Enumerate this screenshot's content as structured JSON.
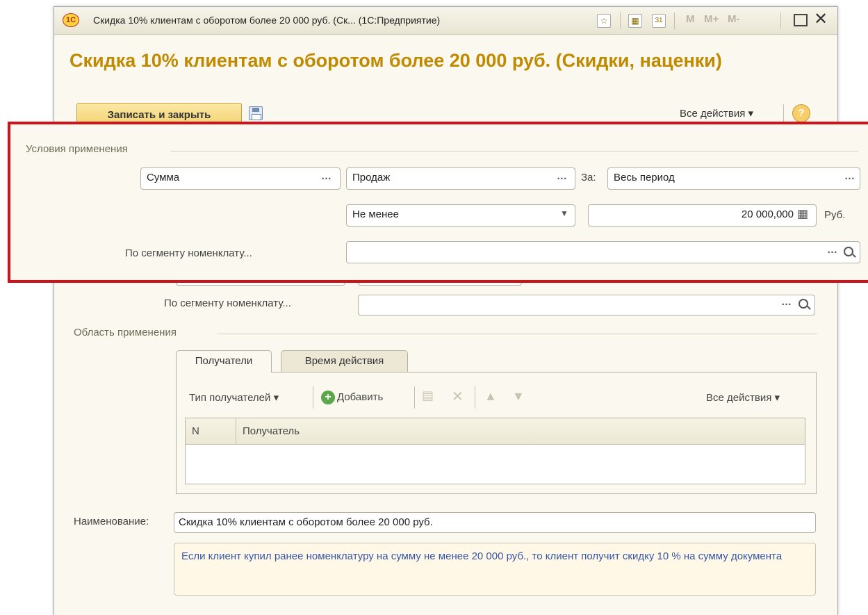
{
  "window": {
    "logo": "1С",
    "title": "Скидка 10% клиентам с оборотом более 20 000 руб. (Ск...   (1С:Предприятие)",
    "m_buttons": [
      "M",
      "M+",
      "M-"
    ]
  },
  "form": {
    "title": "Скидка 10% клиентам с оборотом более 20 000 руб. (Скидки, наценки)",
    "save_close": "Записать и закрыть",
    "all_actions": "Все действия ▾",
    "help": "?"
  },
  "conditions": {
    "group_title": "Условия применения",
    "sum_field": "Сумма",
    "sales_field": "Продаж",
    "period_label": "За:",
    "period_field": "Весь период",
    "compare_field": "Не менее",
    "amount_field": "20 000,000",
    "currency": "Руб.",
    "segment_label": "По сегменту номенклату...",
    "segment_field": ""
  },
  "background": {
    "segment_label": "По сегменту номенклату...",
    "segment_field": ""
  },
  "scope": {
    "group_title": "Область применения",
    "tabs": [
      "Получатели",
      "Время действия"
    ],
    "recipient_type": "Тип получателей ▾",
    "add": "Добавить",
    "all_actions": "Все действия ▾",
    "columns": [
      "N",
      "Получатель"
    ]
  },
  "name": {
    "label": "Наименование:",
    "value": "Скидка 10% клиентам с оборотом более 20 000 руб.",
    "description": "Если клиент купил ранее номенклатуру на сумму не менее 20 000 руб., то клиент получит скидку 10 % на сумму документа"
  },
  "colors": {
    "title": "#c08a00",
    "highlight": "#d0121b",
    "form_bg": "#fbf9ef"
  }
}
